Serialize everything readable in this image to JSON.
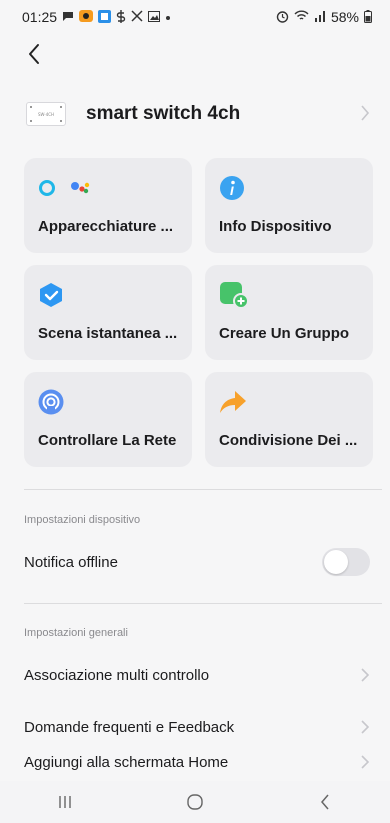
{
  "status_bar": {
    "time": "01:25",
    "battery": "58%",
    "left_icons": [
      "chat-icon",
      "app-icon-orange",
      "app-icon-blue",
      "dollar-icon",
      "tool-icon",
      "image-icon",
      "dot-icon"
    ],
    "right_icons": [
      "alarm-icon",
      "wifi-icon",
      "signal-icon",
      "battery-icon"
    ]
  },
  "device": {
    "name": "smart switch 4ch",
    "thumb_text": "SW-4CH"
  },
  "tiles": [
    {
      "label": "Apparecchiature ...",
      "icon": "alexa-google-icon"
    },
    {
      "label": "Info Dispositivo",
      "icon": "info-icon"
    },
    {
      "label": "Scena istantanea ...",
      "icon": "scene-check-icon"
    },
    {
      "label": "Creare Un Gruppo",
      "icon": "group-add-icon"
    },
    {
      "label": "Controllare La Rete",
      "icon": "network-icon"
    },
    {
      "label": "Condivisione Dei ...",
      "icon": "share-arrow-icon"
    }
  ],
  "device_settings": {
    "header": "Impostazioni dispositivo",
    "offline_label": "Notifica offline",
    "offline_enabled": false
  },
  "general_settings": {
    "header": "Impostazioni generali",
    "items": [
      "Associazione multi controllo",
      "Domande frequenti e Feedback",
      "Aggiungi alla schermata Home"
    ]
  },
  "colors": {
    "background": "#f6f6f7",
    "card": "#ebebee",
    "info_blue": "#3aa3f0",
    "scene_blue": "#2d97f2",
    "group_green": "#47c36a",
    "network_blue": "#5a8ff0",
    "share_orange": "#f7a12b"
  }
}
